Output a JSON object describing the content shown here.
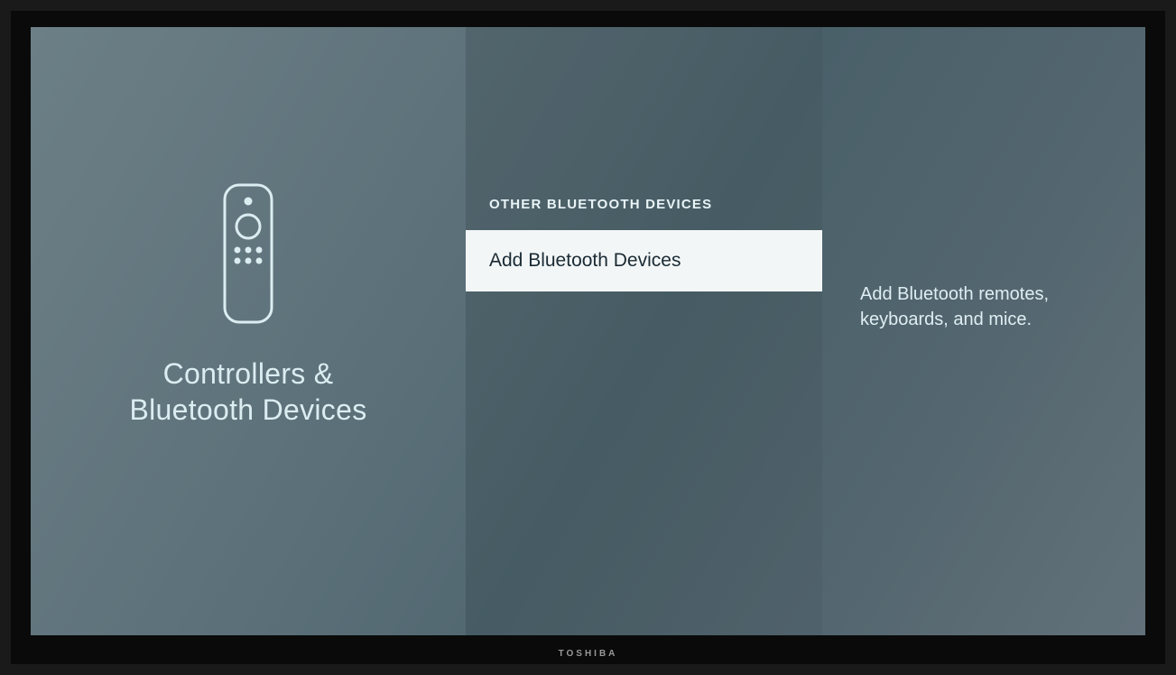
{
  "left": {
    "title_line1": "Controllers &",
    "title_line2": "Bluetooth Devices"
  },
  "middle": {
    "header": "OTHER BLUETOOTH DEVICES",
    "items": [
      {
        "label": "Add Bluetooth Devices",
        "selected": true
      }
    ]
  },
  "right": {
    "description": "Add Bluetooth remotes, keyboards, and mice."
  },
  "tv_brand": "TOSHIBA"
}
